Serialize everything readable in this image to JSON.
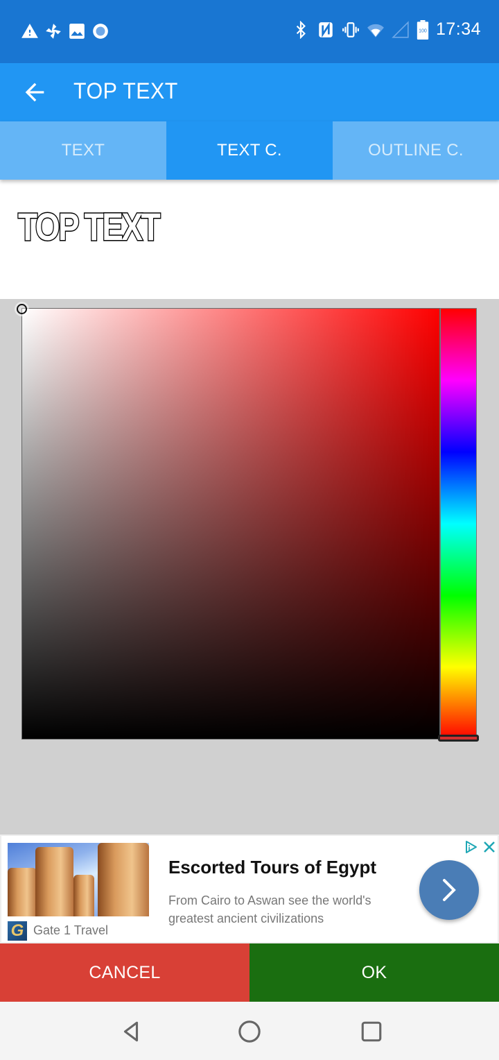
{
  "status_bar": {
    "time": "17:34",
    "battery_level": "100",
    "left_icons": [
      "warning-icon",
      "pinwheel-icon",
      "image-icon",
      "record-icon"
    ],
    "right_icons": [
      "bluetooth-icon",
      "nfc-icon",
      "vibrate-icon",
      "wifi-icon",
      "cell-signal-icon",
      "battery-icon"
    ]
  },
  "app_bar": {
    "title": "TOP TEXT",
    "back_icon": "arrow-left-icon"
  },
  "tabs": [
    {
      "label": "TEXT",
      "active": false
    },
    {
      "label": "TEXT C.",
      "active": true
    },
    {
      "label": "OUTLINE C.",
      "active": false
    }
  ],
  "preview": {
    "text": "TOP TEXT",
    "fill_color": "#ffffff",
    "outline_color": "#000000"
  },
  "color_picker": {
    "hue_degrees": 0,
    "saturation": 0,
    "value": 1,
    "selected_color": "#ffffff"
  },
  "ad": {
    "title": "Escorted Tours of Egypt",
    "description": "From Cairo to Aswan see the world's greatest ancient civilizations",
    "advertiser": "Gate 1 Travel",
    "logo_letter": "G"
  },
  "buttons": {
    "cancel": "CANCEL",
    "ok": "OK"
  },
  "colors": {
    "status_bar": "#1976d2",
    "app_bar": "#2196f3",
    "tab_inactive": "#64b5f6",
    "cancel": "#d84036",
    "ok": "#1a6e10",
    "ad_button": "#4a7db6"
  }
}
